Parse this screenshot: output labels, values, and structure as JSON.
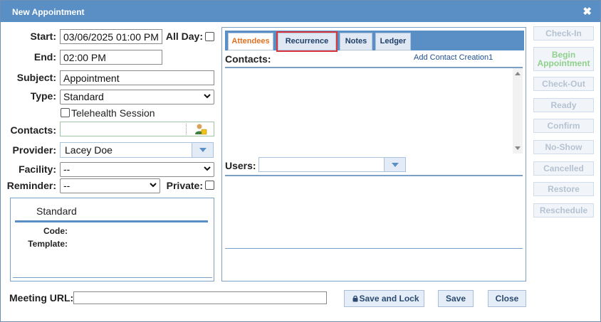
{
  "dialog": {
    "title": "New Appointment",
    "close_glyph": "✖"
  },
  "form": {
    "start_label": "Start:",
    "start_value": "03/06/2025 01:00 PM",
    "allday_label": "All Day:",
    "end_label": "End:",
    "end_value": "02:00 PM",
    "subject_label": "Subject:",
    "subject_value": "Appointment",
    "type_label": "Type:",
    "type_value": "Standard",
    "telehealth_label": "Telehealth Session",
    "contacts_label": "Contacts:",
    "provider_label": "Provider:",
    "provider_value": "Lacey Doe",
    "facility_label": "Facility:",
    "facility_value": "--",
    "reminder_label": "Reminder:",
    "reminder_value": "--",
    "private_label": "Private:",
    "meeting_url_label": "Meeting URL:"
  },
  "info": {
    "title": "Standard",
    "code_label": "Code:",
    "template_label": "Template:"
  },
  "tabs": [
    {
      "label": "Attendees",
      "active": true
    },
    {
      "label": "Recurrence",
      "highlighted": true
    },
    {
      "label": "Notes"
    },
    {
      "label": "Ledger"
    }
  ],
  "attendees": {
    "contacts_label": "Contacts:",
    "add_contact_link": "Add Contact Creation1",
    "users_label": "Users:"
  },
  "side_buttons": [
    "Check-In",
    "Begin Appointment",
    "Check-Out",
    "Ready",
    "Confirm",
    "No-Show",
    "Cancelled",
    "Restore",
    "Reschedule"
  ],
  "footer": {
    "save_lock": "Save and Lock",
    "save": "Save",
    "close": "Close"
  },
  "colors": {
    "titlebar": "#5a8fc6",
    "active_tab": "#e07020",
    "highlight": "#d9363e",
    "begin_appt": "#8fd08a"
  }
}
